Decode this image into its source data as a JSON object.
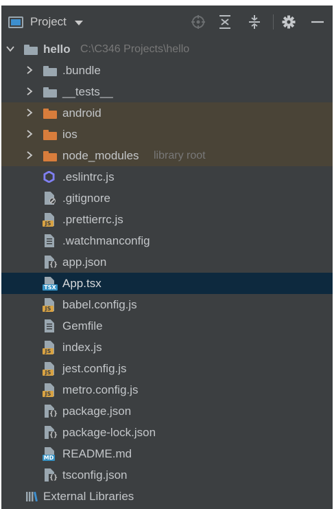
{
  "toolbar": {
    "title": "Project",
    "icons": [
      "locate-icon",
      "expand-all-icon",
      "collapse-all-icon",
      "gear-icon",
      "minimize-icon"
    ]
  },
  "tree": {
    "root": {
      "name": "hello",
      "path": "C:\\C346 Projects\\hello"
    },
    "folders": [
      {
        "name": ".bundle",
        "color": "#9aa7b0"
      },
      {
        "name": "__tests__",
        "color": "#9aa7b0"
      },
      {
        "name": "android",
        "color": "#d87d3c"
      },
      {
        "name": "ios",
        "color": "#d87d3c"
      },
      {
        "name": "node_modules",
        "color": "#d87d3c",
        "hint": "library root"
      }
    ],
    "files": [
      {
        "name": ".eslintrc.js",
        "icon": "eslint-icon"
      },
      {
        "name": ".gitignore",
        "icon": "ignore-file-icon"
      },
      {
        "name": ".prettierrc.js",
        "icon": "js-file-icon"
      },
      {
        "name": ".watchmanconfig",
        "icon": "text-file-icon"
      },
      {
        "name": "app.json",
        "icon": "json-file-icon"
      },
      {
        "name": "App.tsx",
        "icon": "tsx-file-icon",
        "selected": true
      },
      {
        "name": "babel.config.js",
        "icon": "js-file-icon"
      },
      {
        "name": "Gemfile",
        "icon": "text-file-icon"
      },
      {
        "name": "index.js",
        "icon": "js-file-icon"
      },
      {
        "name": "jest.config.js",
        "icon": "js-file-icon"
      },
      {
        "name": "metro.config.js",
        "icon": "js-file-icon"
      },
      {
        "name": "package.json",
        "icon": "json-file-icon"
      },
      {
        "name": "package-lock.json",
        "icon": "json-file-icon"
      },
      {
        "name": "README.md",
        "icon": "md-file-icon"
      },
      {
        "name": "tsconfig.json",
        "icon": "json-file-icon"
      }
    ],
    "badges": {
      "js": "JS",
      "tsx": "TSX",
      "md": "MD"
    },
    "external_libraries": "External Libraries"
  },
  "colors": {
    "panel_bg": "#3c3f41",
    "selected_bg": "#0d293e",
    "excluded_bg": "#4a4437",
    "text": "#c3c6c9",
    "hint": "#787878",
    "folder_grey": "#9aa7b0",
    "folder_orange": "#d87d3c",
    "js_badge": "#d9a343",
    "ts_badge": "#3592c4"
  }
}
